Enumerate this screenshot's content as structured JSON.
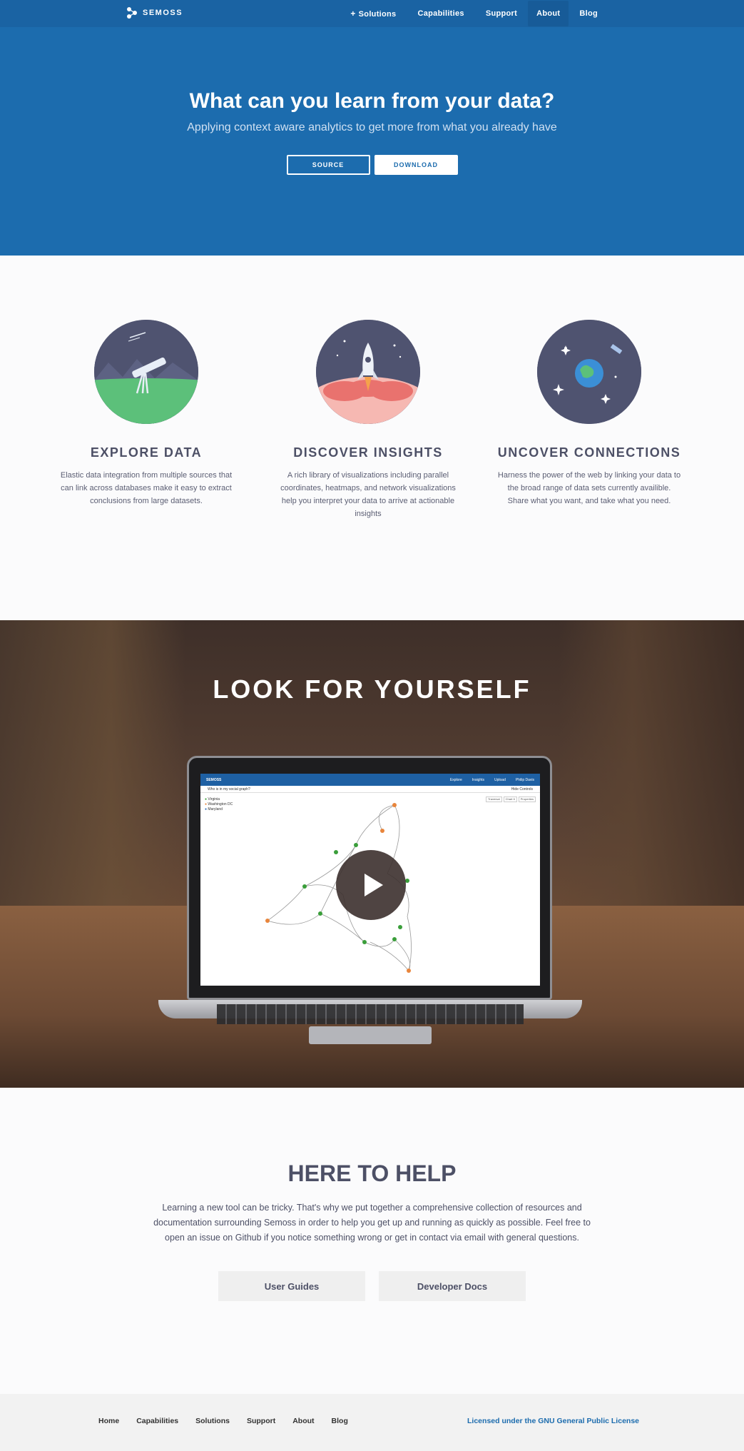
{
  "nav": {
    "brand": "SEMOSS",
    "links": [
      {
        "label": "Solutions",
        "prefix": "+"
      },
      {
        "label": "Capabilities"
      },
      {
        "label": "Support"
      },
      {
        "label": "About"
      },
      {
        "label": "Blog"
      }
    ]
  },
  "hero": {
    "title": "What can you learn from your data?",
    "subtitle": "Applying context aware analytics to get more from what you already have",
    "source_label": "SOURCE",
    "download_label": "DOWNLOAD"
  },
  "features": [
    {
      "title": "EXPLORE DATA",
      "text": "Elastic data integration from multiple sources that can link across databases make it easy to extract conclusions from large datasets.",
      "icon": "telescope-icon"
    },
    {
      "title": "DISCOVER INSIGHTS",
      "text": "A rich library of visualizations including parallel coordinates, heatmaps, and network visualizations help you interpret your data to arrive at actionable insights",
      "icon": "rocket-icon"
    },
    {
      "title": "UNCOVER CONNECTIONS",
      "text": "Harness the power of the web by linking your data to the broad range of data sets currently availible. Share what you want, and take what you need.",
      "icon": "globe-satellite-icon"
    }
  ],
  "video": {
    "title": "LOOK FOR YOURSELF",
    "screen": {
      "brand": "SEMOSS",
      "tabs": [
        "Explore",
        "Insights",
        "Upload",
        "Philip Davis"
      ],
      "question": "Who is in my social graph?",
      "hide_controls": "Hide Controls",
      "legend": [
        "Virginia",
        "Washington DC",
        "Maryland"
      ],
      "tools": [
        "Traversal",
        "Chart It",
        "Properties"
      ]
    }
  },
  "help": {
    "title": "HERE TO HELP",
    "text": "Learning a new tool can be tricky. That's why we put together a comprehensive collection of resources and documentation surrounding Semoss in order to help you get up and running as quickly as possible. Feel free to open an issue on Github if you notice something wrong or get in contact via email with general questions.",
    "user_guides": "User Guides",
    "developer_docs": "Developer Docs"
  },
  "footer": {
    "links": [
      "Home",
      "Capabilities",
      "Solutions",
      "Support",
      "About",
      "Blog"
    ],
    "license": "Licensed under the GNU General Public License"
  },
  "colors": {
    "nav": "#1a63a3",
    "hero": "#1c6cae",
    "heading": "#4d5066",
    "circle": "#4f5370"
  }
}
